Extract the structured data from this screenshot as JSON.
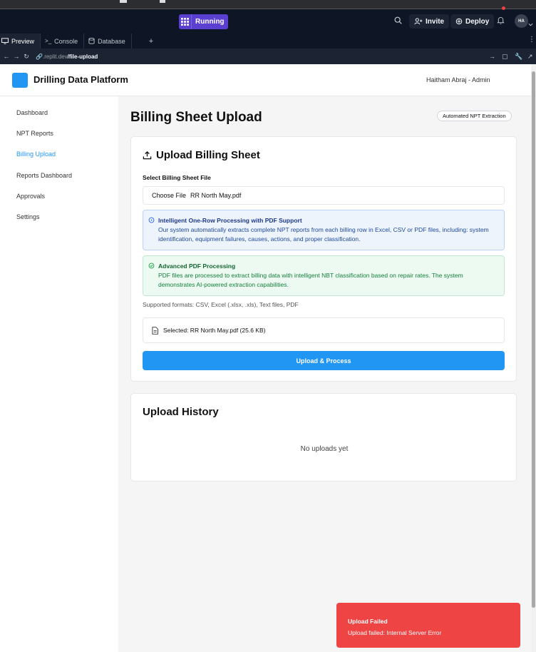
{
  "replit": {
    "status_label": "Running",
    "invite_label": "Invite",
    "deploy_label": "Deploy",
    "avatar_initials": "HA",
    "tabs": [
      {
        "label": "Preview"
      },
      {
        "label": "Console"
      },
      {
        "label": "Database"
      }
    ],
    "url_prefix": ".replit.dev",
    "url_path": "/file-upload"
  },
  "app": {
    "title": "Drilling Data Platform",
    "user": "Haitham Abraj - Admin",
    "brand_color": "#2196f3"
  },
  "sidebar": {
    "items": [
      {
        "label": "Dashboard"
      },
      {
        "label": "NPT Reports"
      },
      {
        "label": "Billing Upload"
      },
      {
        "label": "Reports Dashboard"
      },
      {
        "label": "Approvals"
      },
      {
        "label": "Settings"
      }
    ]
  },
  "main": {
    "page_title": "Billing Sheet Upload",
    "badge": "Automated NPT Extraction",
    "upload_card": {
      "title": "Upload Billing Sheet",
      "field_label": "Select Billing Sheet File",
      "choose_label": "Choose File",
      "file_name": "RR North May.pdf",
      "info_blue": {
        "title": "Intelligent One-Row Processing with PDF Support",
        "body": "Our system automatically extracts complete NPT reports from each billing row in Excel, CSV or PDF files, including: system identification, equipment failures, causes, actions, and proper classification."
      },
      "info_green": {
        "title": "Advanced PDF Processing",
        "body": "PDF files are processed to extract billing data with intelligent NBT classification based on repair rates. The system demonstrates AI-powered extraction capabilities."
      },
      "formats": "Supported formats: CSV, Excel (.xlsx, .xls), Text files, PDF",
      "selected": "Selected: RR North May.pdf (25.6 KB)",
      "button_label": "Upload & Process"
    },
    "history_card": {
      "title": "Upload History",
      "empty_message": "No uploads yet"
    }
  },
  "toast": {
    "title": "Upload Failed",
    "message": "Upload failed: Internal Server Error",
    "color": "#ef4444"
  }
}
